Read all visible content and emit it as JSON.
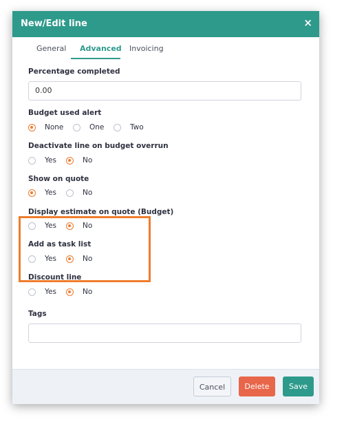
{
  "dialog": {
    "title": "New/Edit line",
    "close_glyph": "×",
    "close_icon": "close-icon"
  },
  "tabs": [
    {
      "label": "General",
      "active": false
    },
    {
      "label": "Advanced",
      "active": true
    },
    {
      "label": "Invoicing",
      "active": false
    }
  ],
  "fields": {
    "percentage": {
      "label": "Percentage completed",
      "value": "0.00"
    },
    "budget_alert": {
      "label": "Budget used alert",
      "options": [
        "None",
        "One",
        "Two"
      ],
      "selected": "None"
    },
    "deactivate": {
      "label": "Deactivate line on budget overrun",
      "options": [
        "Yes",
        "No"
      ],
      "selected": "No"
    },
    "show_on_quote": {
      "label": "Show on quote",
      "options": [
        "Yes",
        "No"
      ],
      "selected": "Yes"
    },
    "display_estimate": {
      "label": "Display estimate on quote (Budget)",
      "options": [
        "Yes",
        "No"
      ],
      "selected": "No"
    },
    "task_list": {
      "label": "Add as task list",
      "options": [
        "Yes",
        "No"
      ],
      "selected": "No"
    },
    "discount": {
      "label": "Discount line",
      "options": [
        "Yes",
        "No"
      ],
      "selected": "No"
    },
    "tags": {
      "label": "Tags",
      "value": ""
    }
  },
  "footer": {
    "cancel": "Cancel",
    "delete": "Delete",
    "save": "Save"
  },
  "colors": {
    "accent": "#2e9a8b",
    "radio": "#ee7a2c",
    "delete": "#e8664a",
    "highlight": "#ef7d2c"
  }
}
